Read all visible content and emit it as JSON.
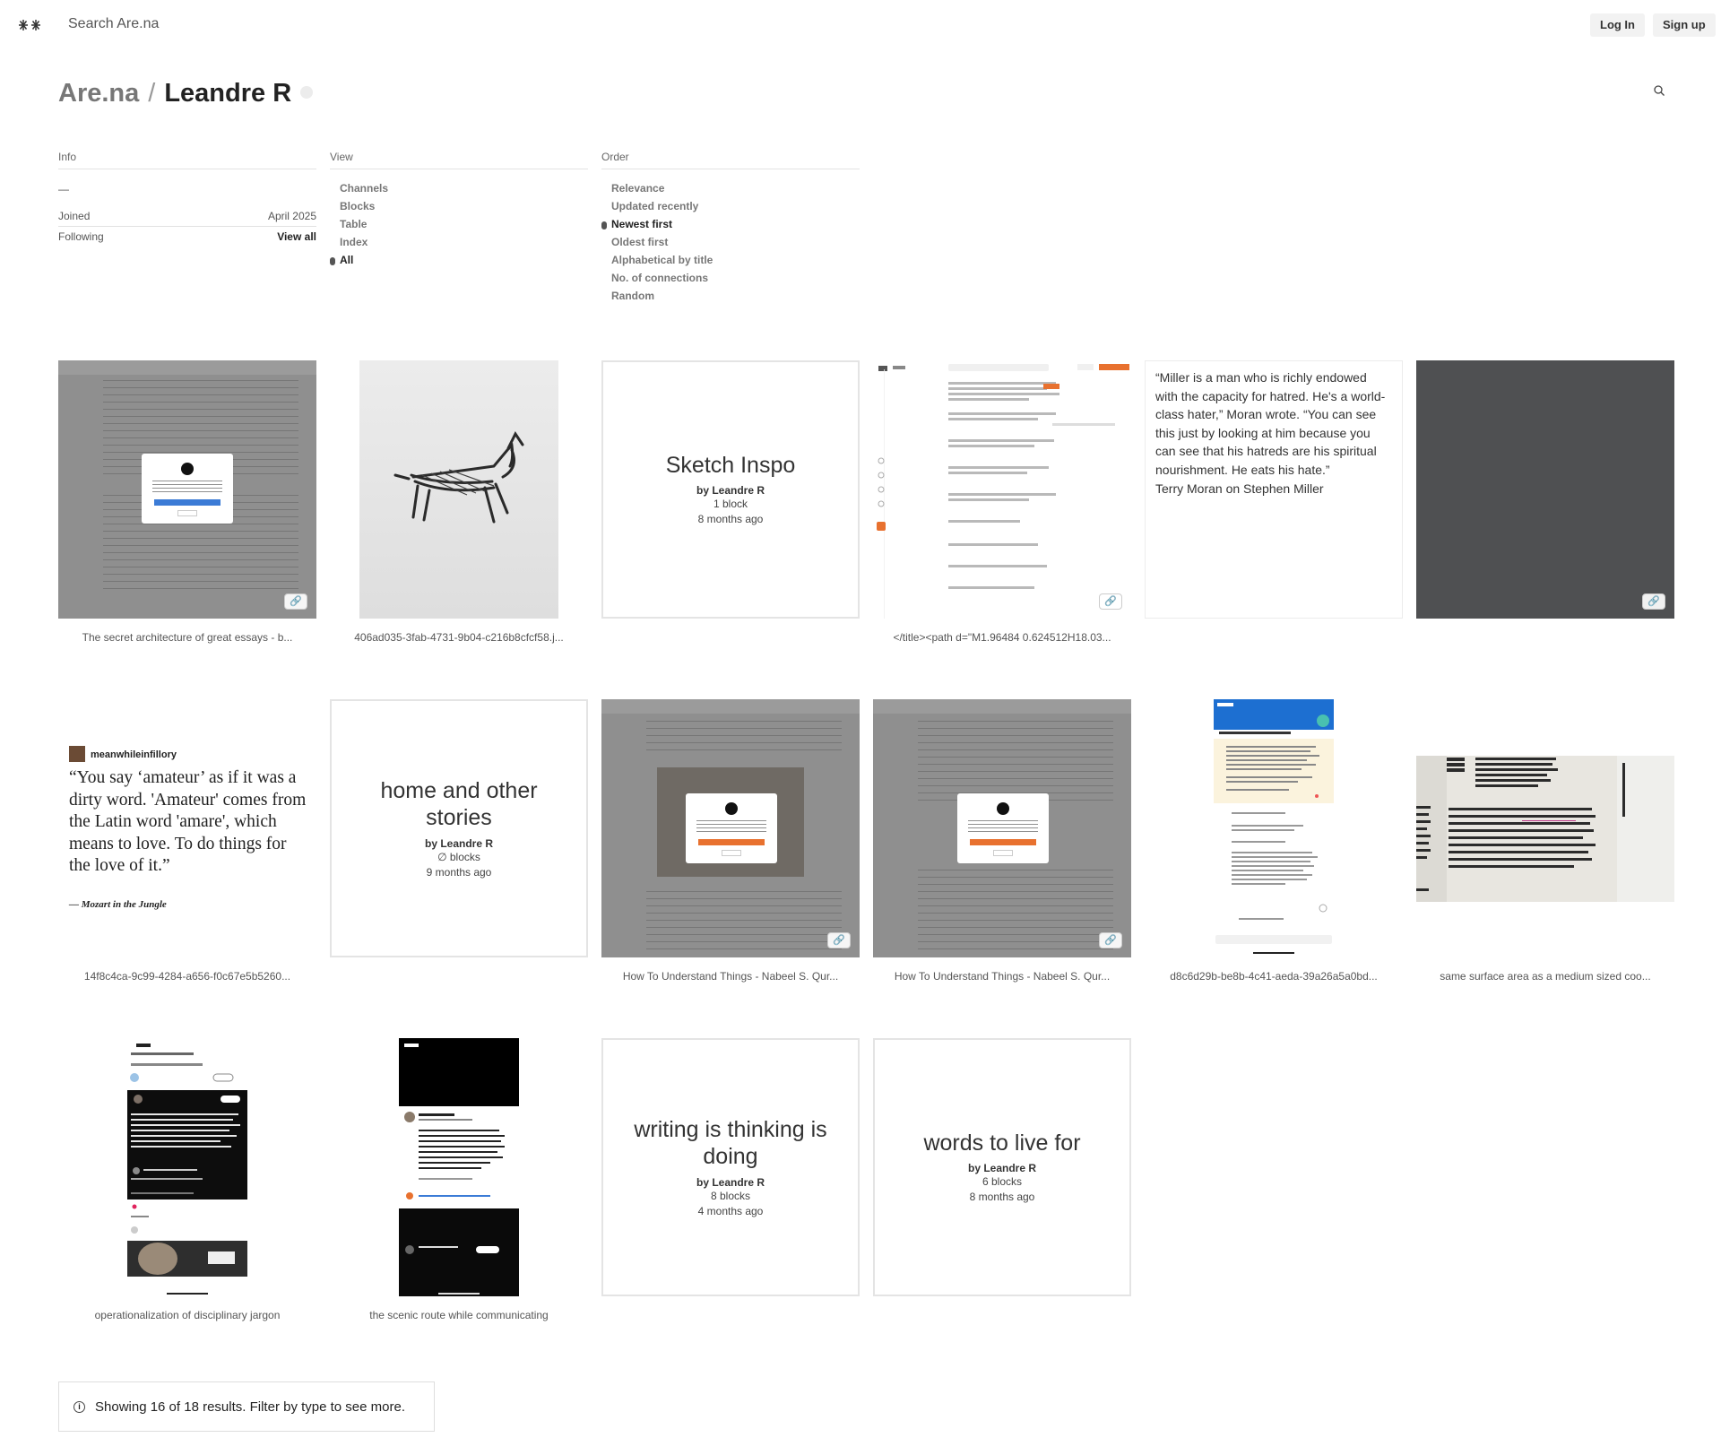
{
  "topbar": {
    "search_label": "Search Are.na",
    "login_label": "Log In",
    "signup_label": "Sign up"
  },
  "header": {
    "root": "Are.na",
    "separator": "/",
    "user": "Leandre R"
  },
  "info": {
    "head": "Info",
    "bio": "—",
    "joined_label": "Joined",
    "joined_value": "April 2025",
    "following_label": "Following",
    "following_value": "View all"
  },
  "view": {
    "head": "View",
    "options": [
      "Channels",
      "Blocks",
      "Table",
      "Index",
      "All"
    ],
    "selected": "All"
  },
  "order": {
    "head": "Order",
    "options": [
      "Relevance",
      "Updated recently",
      "Newest first",
      "Oldest first",
      "Alphabetical by title",
      "No. of connections",
      "Random"
    ],
    "selected": "Newest first"
  },
  "blocks": [
    {
      "type": "image",
      "caption": "The secret architecture of great essays - b..."
    },
    {
      "type": "image",
      "caption": "406ad035-3fab-4731-9b04-c216b8cfcf58.j..."
    },
    {
      "type": "channel",
      "title": "Sketch Inspo",
      "by": "by Leandre R",
      "count": "1 block",
      "time": "8 months ago"
    },
    {
      "type": "image",
      "caption": "</title><path d=\"M1.96484 0.624512H18.03..."
    },
    {
      "type": "text",
      "text": "“Miller is a man who is richly endowed with the capacity for hatred. He's a world-class hater,” Moran wrote. “You can see this just by looking at him because you can see that his hatreds are his spiritual nourishment. He eats his hate.”\nTerry Moran on Stephen Miller"
    },
    {
      "type": "link"
    },
    {
      "type": "image",
      "caption": "14f8c4ca-9c99-4284-a656-f0c67e5b5260...",
      "quote_user": "meanwhileinfillory",
      "quote_text": "“You say ‘amateur’ as if it was a dirty word. 'Amateur' comes from the Latin word 'amare', which means to love. To do things for the love of it.”",
      "quote_source": "— Mozart in the Jungle"
    },
    {
      "type": "channel",
      "title": "home and other stories",
      "by": "by Leandre R",
      "count": "∅ blocks",
      "time": "9 months ago"
    },
    {
      "type": "image",
      "caption": "How To Understand Things - Nabeel S. Qur..."
    },
    {
      "type": "image",
      "caption": "How To Understand Things - Nabeel S. Qur..."
    },
    {
      "type": "image",
      "caption": "d8c6d29b-be8b-4c41-aeda-39a26a5a0bd..."
    },
    {
      "type": "image",
      "caption": "same surface area as a medium sized coo..."
    },
    {
      "type": "image",
      "caption": "operationalization of disciplinary jargon"
    },
    {
      "type": "image",
      "caption": "the scenic route while communicating"
    },
    {
      "type": "channel",
      "title": "writing is thinking is doing",
      "by": "by Leandre R",
      "count": "8 blocks",
      "time": "4 months ago"
    },
    {
      "type": "channel",
      "title": "words to live for",
      "by": "by Leandre R",
      "count": "6 blocks",
      "time": "8 months ago"
    }
  ],
  "notice": {
    "icon": "info-icon",
    "text": "Showing 16 of 18 results. Filter by type to see more."
  },
  "icons": {
    "logo": "arena-logo-icon",
    "search": "search-icon",
    "link": "link-icon"
  },
  "colors": {
    "text": "#333333",
    "muted": "#777777",
    "button_bg": "#f2f2f2",
    "border": "#e4e4e4",
    "dark_block": "#4f5052"
  }
}
